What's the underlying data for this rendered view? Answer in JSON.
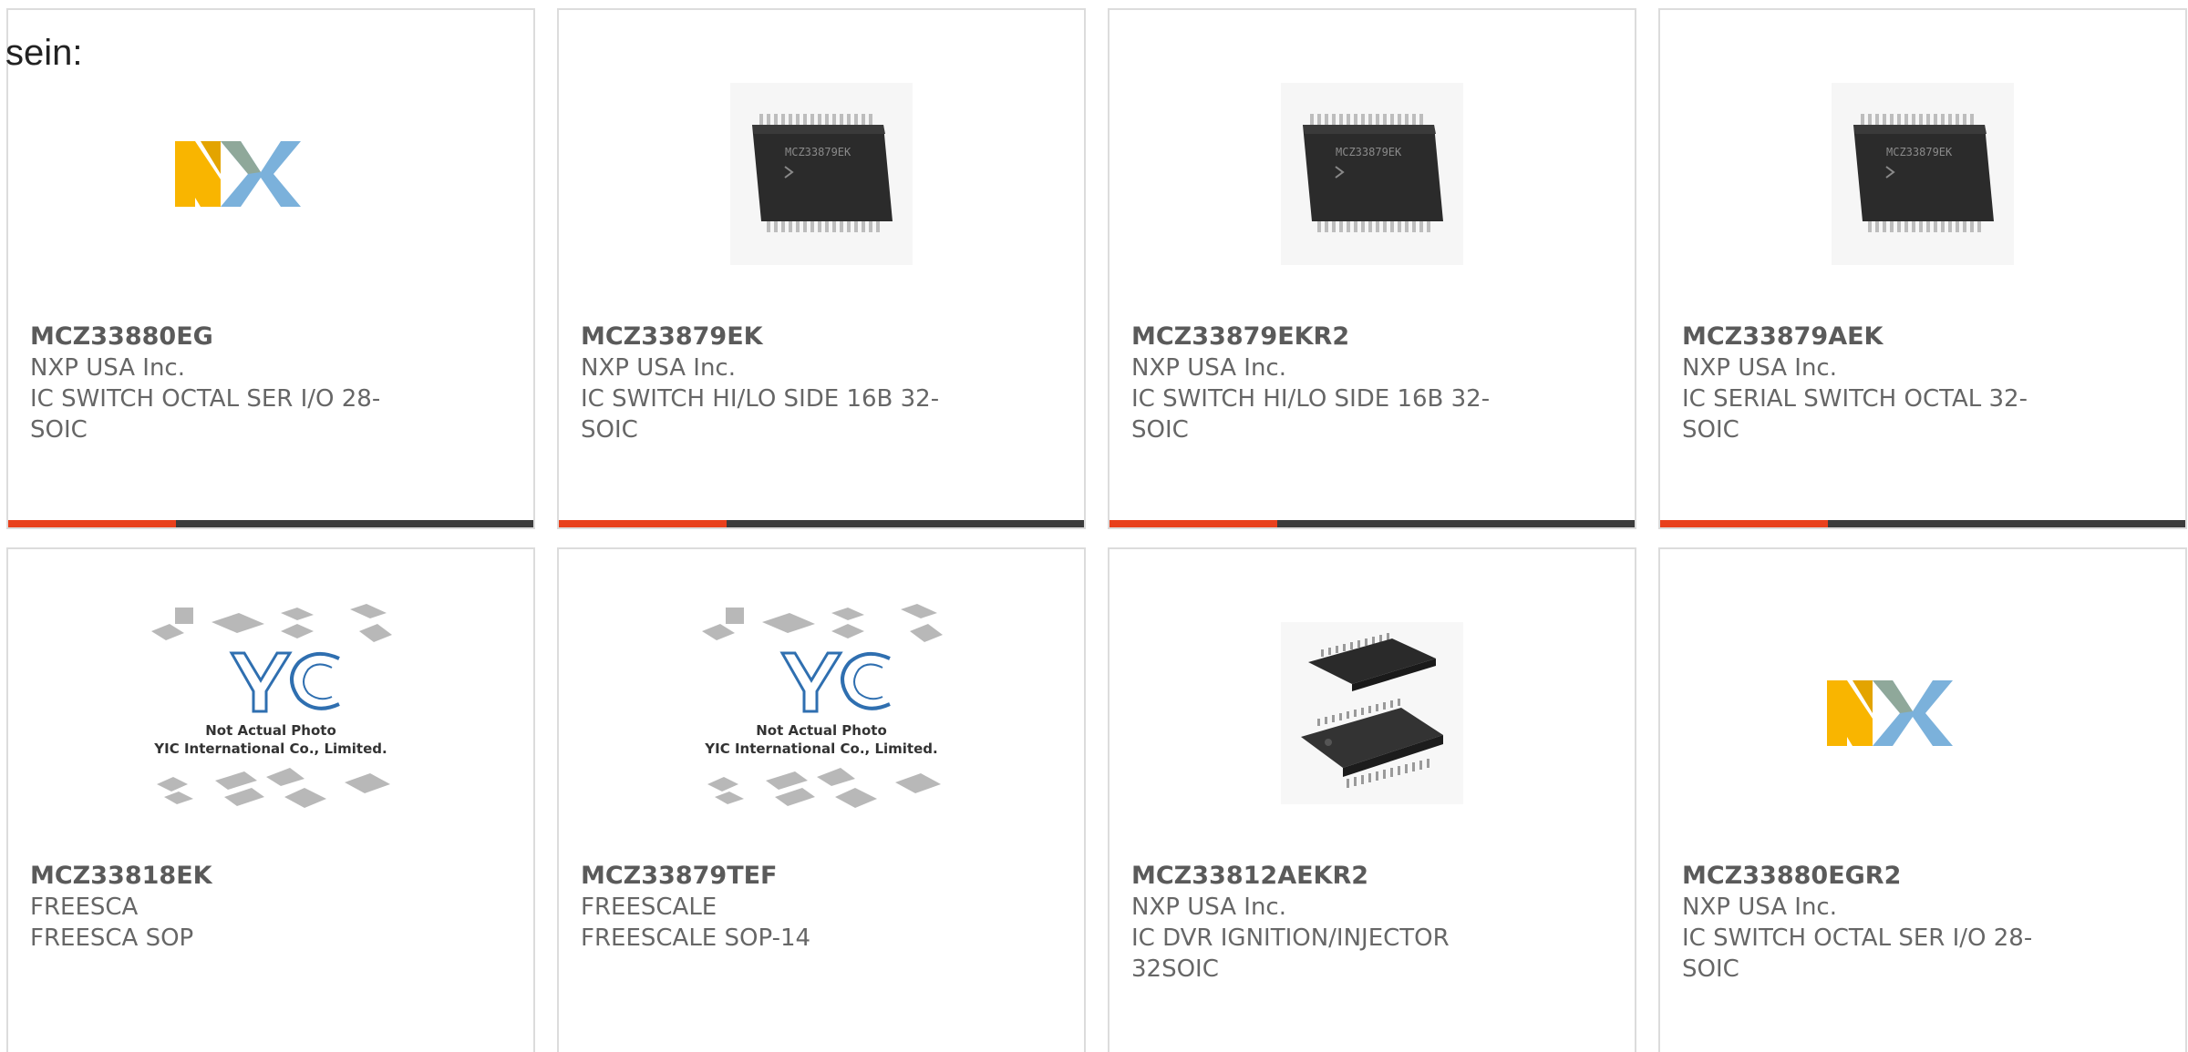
{
  "intro_text": "sein:",
  "cards": [
    {
      "part": "MCZ33880EG",
      "maker": "NXP USA Inc.",
      "desc": "IC SWITCH OCTAL SER I/O 28-SOIC",
      "image": "nxp-logo"
    },
    {
      "part": "MCZ33879EK",
      "maker": "NXP USA Inc.",
      "desc": "IC SWITCH HI/LO SIDE 16B 32-SOIC",
      "image": "chip-soic",
      "chip_marking": "MCZ33879EK"
    },
    {
      "part": "MCZ33879EKR2",
      "maker": "NXP USA Inc.",
      "desc": "IC SWITCH HI/LO SIDE 16B 32-SOIC",
      "image": "chip-soic",
      "chip_marking": "MCZ33879EK"
    },
    {
      "part": "MCZ33879AEK",
      "maker": "NXP USA Inc.",
      "desc": "IC SERIAL SWITCH OCTAL 32-SOIC",
      "image": "chip-soic",
      "chip_marking": "MCZ33879EK"
    },
    {
      "part": "MCZ33818EK",
      "maker": "FREESCA",
      "desc": "FREESCA SOP",
      "image": "yic-placeholder",
      "placeholder_line1": "Not Actual Photo",
      "placeholder_line2": "YIC International Co., Limited."
    },
    {
      "part": "MCZ33879TEF",
      "maker": "FREESCALE",
      "desc": "FREESCALE SOP-14",
      "image": "yic-placeholder",
      "placeholder_line1": "Not Actual Photo",
      "placeholder_line2": "YIC International Co., Limited."
    },
    {
      "part": "MCZ33812AEKR2",
      "maker": "NXP USA Inc.",
      "desc": "IC DVR IGNITION/INJECTOR 32SOIC",
      "image": "chip-pair"
    },
    {
      "part": "MCZ33880EGR2",
      "maker": "NXP USA Inc.",
      "desc": "IC SWITCH OCTAL SER I/O 28-SOIC",
      "image": "nxp-logo"
    }
  ],
  "colors": {
    "accent": "#e8401c",
    "bar": "#3c3c3c",
    "nxp_yellow": "#f9b500",
    "nxp_blue": "#7bb1db",
    "nxp_green": "#c9d200"
  }
}
